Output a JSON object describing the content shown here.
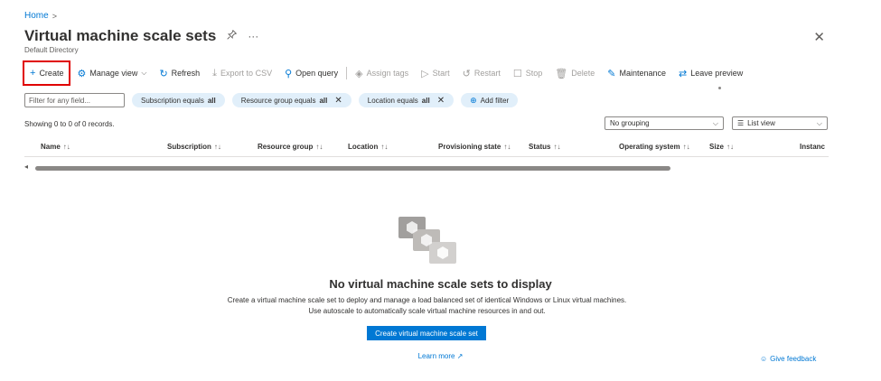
{
  "breadcrumb": {
    "home": "Home",
    "separator": ">"
  },
  "header": {
    "title": "Virtual machine scale sets",
    "subtitle": "Default Directory",
    "pin_glyph": "📌",
    "more_glyph": "···",
    "close_glyph": "✕"
  },
  "toolbar": {
    "create": "Create",
    "manage_view": "Manage view",
    "refresh": "Refresh",
    "export_csv": "Export to CSV",
    "open_query": "Open query",
    "assign_tags": "Assign tags",
    "start": "Start",
    "restart": "Restart",
    "stop": "Stop",
    "delete": "Delete",
    "maintenance": "Maintenance",
    "leave_preview": "Leave preview"
  },
  "filters": {
    "search_placeholder": "Filter for any field...",
    "subscription": {
      "label": "Subscription equals",
      "value": "all"
    },
    "resource_group": {
      "label": "Resource group equals",
      "value": "all"
    },
    "location": {
      "label": "Location equals",
      "value": "all"
    },
    "add_filter": "Add filter"
  },
  "records_text": "Showing 0 to 0 of 0 records.",
  "grouping": {
    "selected": "No grouping"
  },
  "view_mode": {
    "selected": "List view"
  },
  "table": {
    "columns": [
      {
        "label": "Name",
        "arrows": "↑↓"
      },
      {
        "label": "Subscription",
        "arrows": "↑↓"
      },
      {
        "label": "Resource group",
        "arrows": "↑↓"
      },
      {
        "label": "Location",
        "arrows": "↑↓"
      },
      {
        "label": "Provisioning state",
        "arrows": "↑↓"
      },
      {
        "label": "Status",
        "arrows": "↑↓"
      },
      {
        "label": "Operating system",
        "arrows": "↑↓"
      },
      {
        "label": "Size",
        "arrows": "↑↓"
      },
      {
        "label": "Instanc",
        "arrows": ""
      }
    ]
  },
  "empty_state": {
    "title": "No virtual machine scale sets to display",
    "description": "Create a virtual machine scale set to deploy and manage a load balanced set of identical Windows or Linux virtual machines. Use autoscale to automatically scale virtual machine resources in and out.",
    "button": "Create virtual machine scale set",
    "learn_more": "Learn more"
  },
  "feedback": "Give feedback",
  "colors": {
    "accent": "#0078d4",
    "highlight_border": "#e00000",
    "pill_bg": "#e1effa"
  }
}
